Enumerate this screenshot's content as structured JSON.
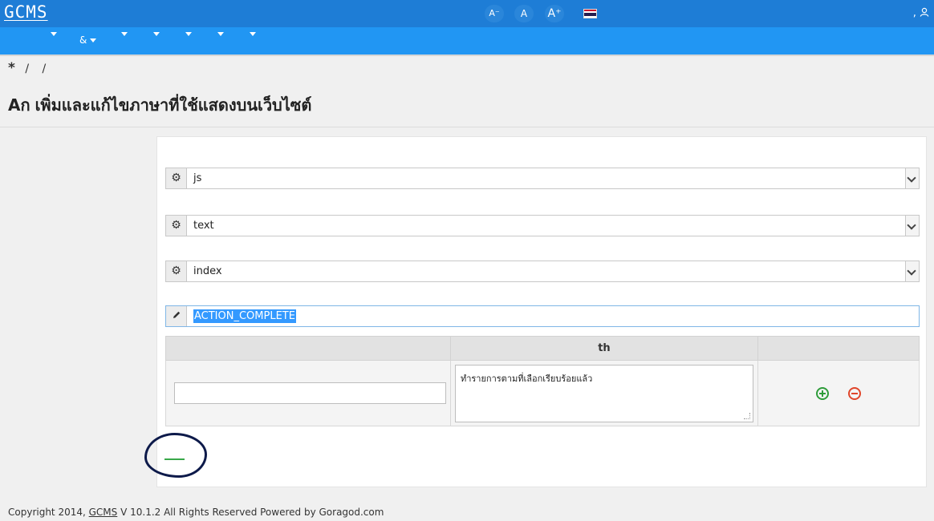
{
  "header": {
    "logo": "GCMS",
    "font_small": "A⁻",
    "font_normal": "A",
    "font_large": "A⁺",
    "user_prefix": ","
  },
  "nav": {
    "item_amp": "&"
  },
  "breadcrumb": {
    "home_icon": "*",
    "sep1": "/",
    "sep2": "/"
  },
  "page": {
    "lang_icon": "Aก",
    "title": "เพิ่มและแก้ไขภาษาที่ใช้แสดงบนเว็บไซต์"
  },
  "form": {
    "type_value": "js",
    "kind_value": "text",
    "owner_value": "index",
    "key_value": "ACTION_COMPLETE"
  },
  "grid": {
    "header_key": "",
    "header_lang": "th",
    "header_actions": "",
    "key_value": "",
    "th_text": "ทำรายการตามที่เลือกเรียบร้อยแล้ว"
  },
  "footer": {
    "prefix": "Copyright 2014, ",
    "brand": "GCMS",
    "suffix": " V 10.1.2 All Rights Reserved Powered by Goragod.com"
  },
  "icons": {
    "gear": "gear-icon",
    "pencil": "pencil-icon",
    "user": "user-icon",
    "flag": "thai-flag-icon"
  }
}
